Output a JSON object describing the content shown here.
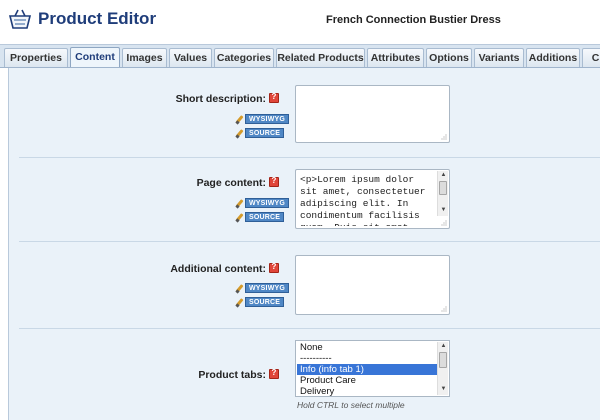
{
  "header": {
    "app_title": "Product Editor",
    "product_name": "French Connection Bustier Dress",
    "icon": "basket-icon"
  },
  "tabs": [
    {
      "label": "Properties",
      "active": false
    },
    {
      "label": "Content",
      "active": true
    },
    {
      "label": "Images",
      "active": false
    },
    {
      "label": "Values",
      "active": false
    },
    {
      "label": "Categories",
      "active": false
    },
    {
      "label": "Related Products",
      "active": false
    },
    {
      "label": "Attributes",
      "active": false
    },
    {
      "label": "Options",
      "active": false
    },
    {
      "label": "Variants",
      "active": false
    },
    {
      "label": "Additions",
      "active": false
    },
    {
      "label": "Cl",
      "active": false
    }
  ],
  "editor_modes": {
    "wysiwyg": "WYSIWYG",
    "source": "SOURCE"
  },
  "fields": {
    "short_description": {
      "label": "Short description:",
      "value": ""
    },
    "page_content": {
      "label": "Page content:",
      "value": "<p>Lorem ipsum dolor sit amet, consectetuer adipiscing elit. In condimentum facilisis quam. Duis sit amet"
    },
    "additional_content": {
      "label": "Additional content:",
      "value": ""
    },
    "product_tabs": {
      "label": "Product tabs:",
      "options": [
        "None",
        "----------",
        "Info (info tab 1)",
        "Product Care",
        "Delivery"
      ],
      "selected": "Info (info tab 1)",
      "hint": "Hold CTRL to select multiple"
    }
  },
  "colors": {
    "title": "#1f3d7a",
    "panel_bg": "#eaf2f9",
    "mode_button": "#4f87c5",
    "help_icon": "#e0463a",
    "selected_option": "#3875d7"
  }
}
